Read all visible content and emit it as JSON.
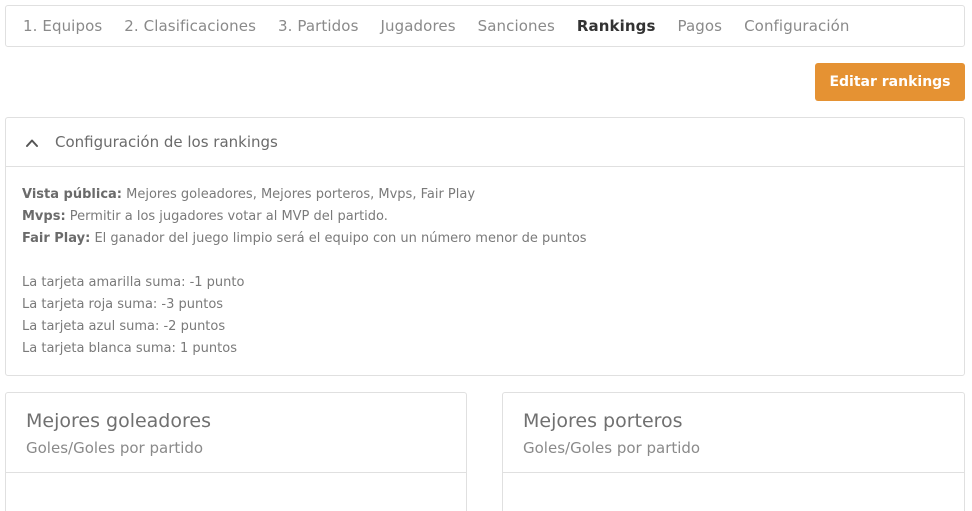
{
  "tabs": [
    {
      "label": "1. Equipos",
      "active": false
    },
    {
      "label": "2. Clasificaciones",
      "active": false
    },
    {
      "label": "3. Partidos",
      "active": false
    },
    {
      "label": "Jugadores",
      "active": false
    },
    {
      "label": "Sanciones",
      "active": false
    },
    {
      "label": "Rankings",
      "active": true
    },
    {
      "label": "Pagos",
      "active": false
    },
    {
      "label": "Configuración",
      "active": false
    }
  ],
  "toolbar": {
    "edit_label": "Editar rankings"
  },
  "config": {
    "title": "Configuración de los rankings",
    "icon": "chevron-up-icon",
    "public_view": {
      "label": "Vista pública:",
      "value": " Mejores goleadores, Mejores porteros, Mvps, Fair Play"
    },
    "mvps": {
      "label": "Mvps:",
      "value": " Permitir a los jugadores votar al MVP del partido."
    },
    "fair_play": {
      "label": "Fair Play:",
      "value": " El ganador del juego limpio será el equipo con un número menor de puntos"
    },
    "cards": [
      "La tarjeta amarilla suma: -1 punto",
      "La tarjeta roja suma: -3 puntos",
      "La tarjeta azul suma: -2 puntos",
      "La tarjeta blanca suma: 1 puntos"
    ]
  },
  "rankings": [
    {
      "title": "Mejores goleadores",
      "subtitle": "Goles/Goles por partido"
    },
    {
      "title": "Mejores porteros",
      "subtitle": "Goles/Goles por partido"
    }
  ],
  "colors": {
    "accent": "#e59233",
    "border": "#e0e0e0",
    "active_tab": "#333333"
  }
}
